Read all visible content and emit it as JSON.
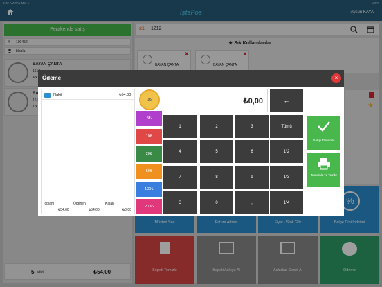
{
  "status": {
    "left": "9:22 AM  Thu Mar 1",
    "right": "100%"
  },
  "app": {
    "logo": "iştePos",
    "user": "Aysun KAYA"
  },
  "left": {
    "sale_button": "Perakende satış",
    "code": "100452",
    "customer": "blabla",
    "items": [
      {
        "name": "BAYAN ÇANTA",
        "code": "1612",
        "qty": "4 x"
      },
      {
        "name": "BAY",
        "code": "1612",
        "qty": "1 x"
      }
    ],
    "count": "5",
    "count_unit": "adet",
    "total": "₺54,00"
  },
  "right": {
    "qty_prefix": "x1",
    "search_value": "1212",
    "favs_title": "Sık Kullanılanlar",
    "fav_items": [
      "BAYAN ÇANTA",
      "BAYAN ÇANTA"
    ],
    "tiles_row1": [
      "Müşteri Seç",
      "Fatura Adresi",
      "Fiyat - Stok Gör",
      "Belge Dibi İndirimi"
    ],
    "tiles_row2": [
      "Sepeti Temizle",
      "Sepeti Askıya Al",
      "Askıdan Sepet Al",
      "Ödeme"
    ]
  },
  "modal": {
    "title": "Ödeme",
    "close": "×",
    "pay_method": "Nakit",
    "pay_amount": "₺54,00",
    "total_label": "Toplam",
    "total_value": "₺54,00",
    "paid_label": "Ödenen",
    "paid_value": "₺54,00",
    "remaining_label": "Kalan",
    "remaining_value": "₺0,00",
    "coins": [
      "1₺",
      "5₺",
      "10₺",
      "20₺",
      "50₺",
      "100₺",
      "200₺"
    ],
    "coin_colors": [
      "#f0c34a",
      "#b040cc",
      "#e04848",
      "#3a8a47",
      "#f0901e",
      "#3a7ee0",
      "#e0387a"
    ],
    "display": "₺0,00",
    "backspace": "←",
    "keys": [
      [
        "1",
        "2",
        "3",
        "Tümü"
      ],
      [
        "4",
        "5",
        "6",
        "1/2"
      ],
      [
        "7",
        "8",
        "9",
        "1/3"
      ],
      [
        "C",
        "0",
        ",",
        "1/4"
      ]
    ],
    "btn_complete": "Satışı Tamamla",
    "btn_complete_print": "Tamamla ve Yazdır"
  }
}
